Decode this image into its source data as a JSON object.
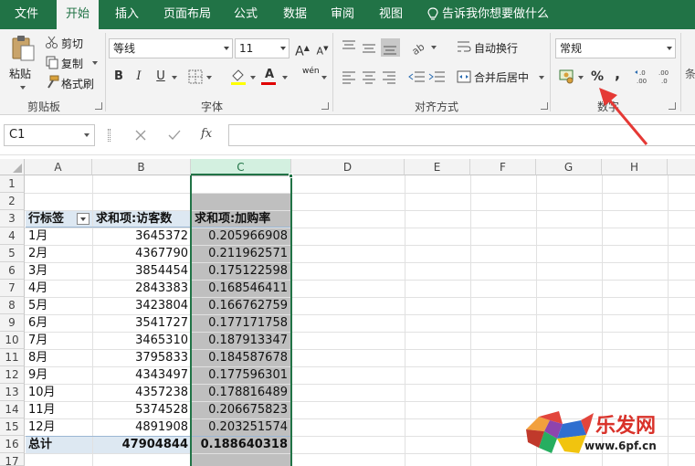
{
  "tabs": {
    "file": "文件",
    "home": "开始",
    "insert": "插入",
    "page_layout": "页面布局",
    "formulas": "公式",
    "data": "数据",
    "review": "审阅",
    "view": "视图",
    "tell_me": "告诉我你想要做什么"
  },
  "ribbon": {
    "clipboard": {
      "paste": "粘贴",
      "cut": "剪切",
      "copy": "复制",
      "format_painter": "格式刷",
      "label": "剪贴板"
    },
    "font": {
      "font_name": "等线",
      "font_size": "11",
      "grow": "A",
      "shrink": "A",
      "bold": "B",
      "italic": "I",
      "underline": "U",
      "font_color": "A",
      "phonetic": "wén",
      "label": "字体"
    },
    "alignment": {
      "wrap_text": "自动换行",
      "merge_center": "合并后居中",
      "label": "对齐方式"
    },
    "number": {
      "format": "常规",
      "percent": "%",
      "comma": ",",
      "label": "数字"
    }
  },
  "formula_bar": {
    "name_box": "C1",
    "fx": "fx",
    "value": ""
  },
  "columns": [
    "A",
    "B",
    "C",
    "D",
    "E",
    "F",
    "G",
    "H"
  ],
  "rows": [
    "1",
    "2",
    "3",
    "4",
    "5",
    "6",
    "7",
    "8",
    "9",
    "10",
    "11",
    "12",
    "13",
    "14",
    "15",
    "16",
    "17"
  ],
  "pivot": {
    "header": [
      "行标签",
      "求和项:访客数",
      "求和项:加购率"
    ],
    "data": [
      [
        "1月",
        "3645372",
        "0.205966908"
      ],
      [
        "2月",
        "4367790",
        "0.211962571"
      ],
      [
        "3月",
        "3854454",
        "0.175122598"
      ],
      [
        "4月",
        "2843383",
        "0.168546411"
      ],
      [
        "5月",
        "3423804",
        "0.166762759"
      ],
      [
        "6月",
        "3541727",
        "0.177171758"
      ],
      [
        "7月",
        "3465310",
        "0.187913347"
      ],
      [
        "8月",
        "3795833",
        "0.184587678"
      ],
      [
        "9月",
        "4343497",
        "0.177596301"
      ],
      [
        "10月",
        "4357238",
        "0.178816489"
      ],
      [
        "11月",
        "5374528",
        "0.206675823"
      ],
      [
        "12月",
        "4891908",
        "0.203251574"
      ]
    ],
    "total": [
      "总计",
      "47904844",
      "0.188640318"
    ]
  },
  "watermark": {
    "logo_text": "乐发网",
    "url": "www.6pf.cn"
  },
  "colors": {
    "excel_green": "#217346",
    "annotation_red": "#e53935",
    "selection_gray": "#bfbfbf",
    "pivot_header_blue": "#dde8f2"
  }
}
